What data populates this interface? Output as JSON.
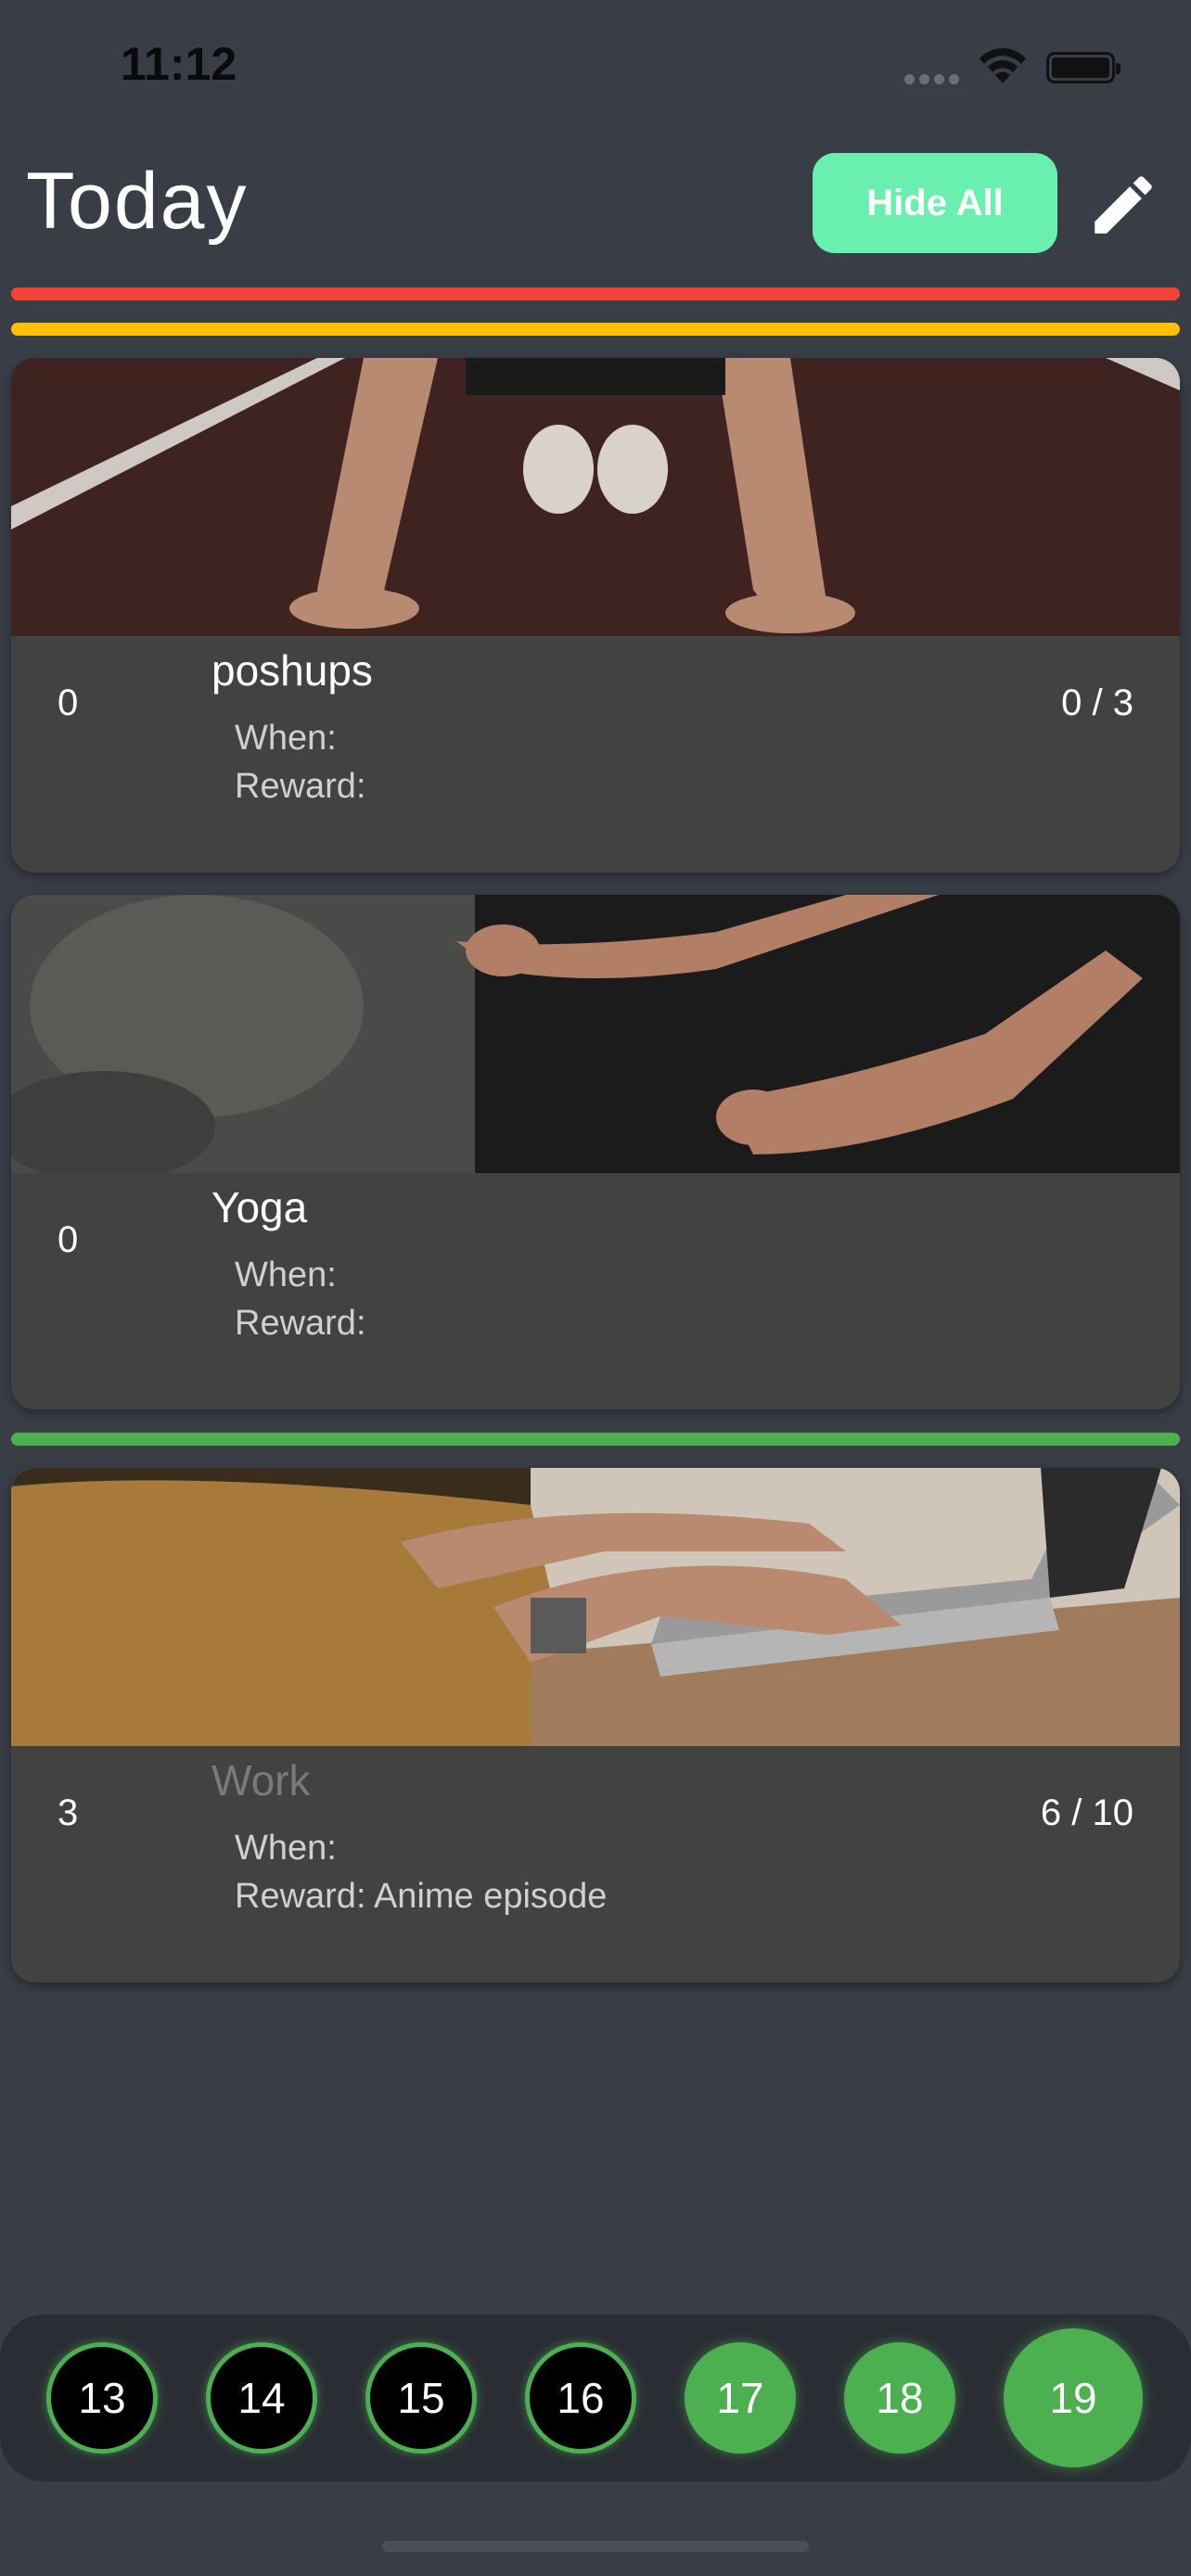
{
  "status_bar": {
    "time": "11:12"
  },
  "header": {
    "title": "Today",
    "hide_all_label": "Hide All"
  },
  "colors": {
    "accent": "#69f0ae",
    "red_bar": "#f44336",
    "yellow_bar": "#ffc107",
    "green_bar": "#4caf50"
  },
  "habits": [
    {
      "name": "poshups",
      "streak": "0",
      "progress": "0 / 3",
      "when": "When:",
      "reward": "Reward:"
    },
    {
      "name": "Yoga",
      "streak": "0",
      "progress": "",
      "when": "When:",
      "reward": "Reward:"
    },
    {
      "name": "Work",
      "streak": "3",
      "progress": "6 / 10",
      "when": "When:",
      "reward": "Reward: Anime episode"
    }
  ],
  "dates": [
    "13",
    "14",
    "15",
    "16",
    "17",
    "18",
    "19"
  ],
  "icons": {
    "edit": "pencil-icon",
    "wifi": "wifi-icon",
    "battery": "battery-icon"
  }
}
